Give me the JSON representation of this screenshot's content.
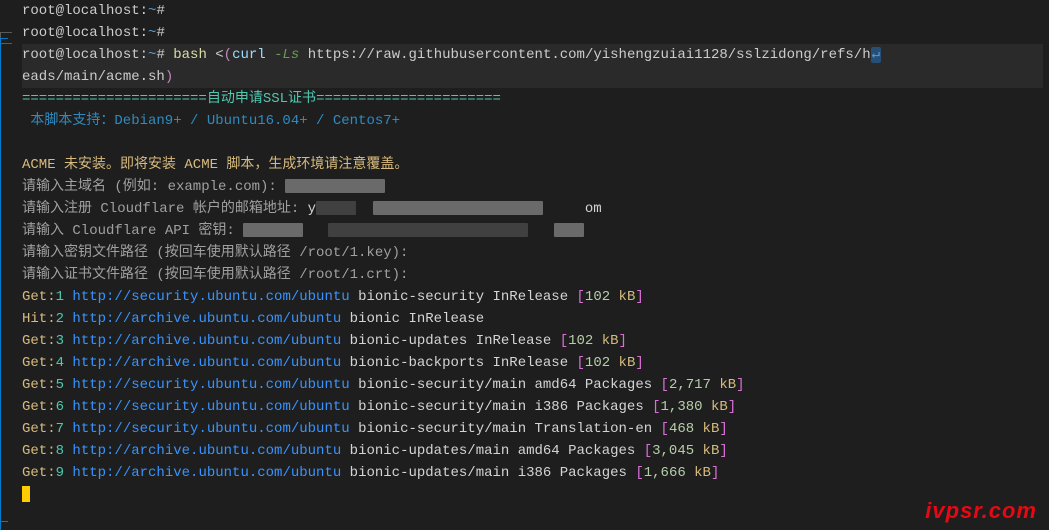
{
  "prompt_lines": {
    "p0": "root@localhost:",
    "tilde": "~",
    "hash": "#"
  },
  "cmd": {
    "bash": "bash",
    "lt": " <",
    "lparen": "(",
    "curl": "curl",
    "flag": " -Ls ",
    "url1": "https://raw.githubusercontent.com/yishengzuiai1128/sslzidong/refs/h",
    "cont": "↵",
    "url2": "eads/main/acme.sh",
    "rparen": ")"
  },
  "header": {
    "eq_left": "======================",
    "title": "自动申请SSL证书",
    "eq_right": "======================",
    "support": " 本脚本支持：Debian9+ / Ubuntu16.04+ / Centos7+"
  },
  "acme_warn": "ACME 未安装。即将安装 ACME 脚本，生成环境请注意覆盖。",
  "inputs": {
    "domain_label": "请输入主域名 (例如: example.com): ",
    "cf_email_label": "请输入注册 Cloudflare 帐户的邮箱地址: ",
    "cf_email_prefix": "y",
    "cf_email_suffix": "om",
    "cf_api_label": "请输入 Cloudflare API 密钥: ",
    "key_label": "请输入密钥文件路径 (按回车使用默认路径 /root/1.key):",
    "crt_label": "请输入证书文件路径 (按回车使用默认路径 /root/1.crt):"
  },
  "apt": [
    {
      "type": "Get",
      "n": "1",
      "url": "http://security.ubuntu.com/ubuntu",
      "suite": " bionic-security InRelease ",
      "size": "102",
      "unit": " kB"
    },
    {
      "type": "Hit",
      "n": "2",
      "url": "http://archive.ubuntu.com/ubuntu",
      "suite": " bionic InRelease",
      "size": null,
      "unit": null
    },
    {
      "type": "Get",
      "n": "3",
      "url": "http://archive.ubuntu.com/ubuntu",
      "suite": " bionic-updates InRelease ",
      "size": "102",
      "unit": " kB"
    },
    {
      "type": "Get",
      "n": "4",
      "url": "http://archive.ubuntu.com/ubuntu",
      "suite": " bionic-backports InRelease ",
      "size": "102",
      "unit": " kB"
    },
    {
      "type": "Get",
      "n": "5",
      "url": "http://security.ubuntu.com/ubuntu",
      "suite": " bionic-security/main amd64 Packages ",
      "size": "2,717",
      "unit": " kB"
    },
    {
      "type": "Get",
      "n": "6",
      "url": "http://security.ubuntu.com/ubuntu",
      "suite": " bionic-security/main i386 Packages ",
      "size": "1,380",
      "unit": " kB"
    },
    {
      "type": "Get",
      "n": "7",
      "url": "http://security.ubuntu.com/ubuntu",
      "suite": " bionic-security/main Translation-en ",
      "size": "468",
      "unit": " kB"
    },
    {
      "type": "Get",
      "n": "8",
      "url": "http://archive.ubuntu.com/ubuntu",
      "suite": " bionic-updates/main amd64 Packages ",
      "size": "3,045",
      "unit": " kB"
    },
    {
      "type": "Get",
      "n": "9",
      "url": "http://archive.ubuntu.com/ubuntu",
      "suite": " bionic-updates/main i386 Packages ",
      "size": "1,666",
      "unit": " kB"
    }
  ],
  "watermark": "ivpsr.com"
}
